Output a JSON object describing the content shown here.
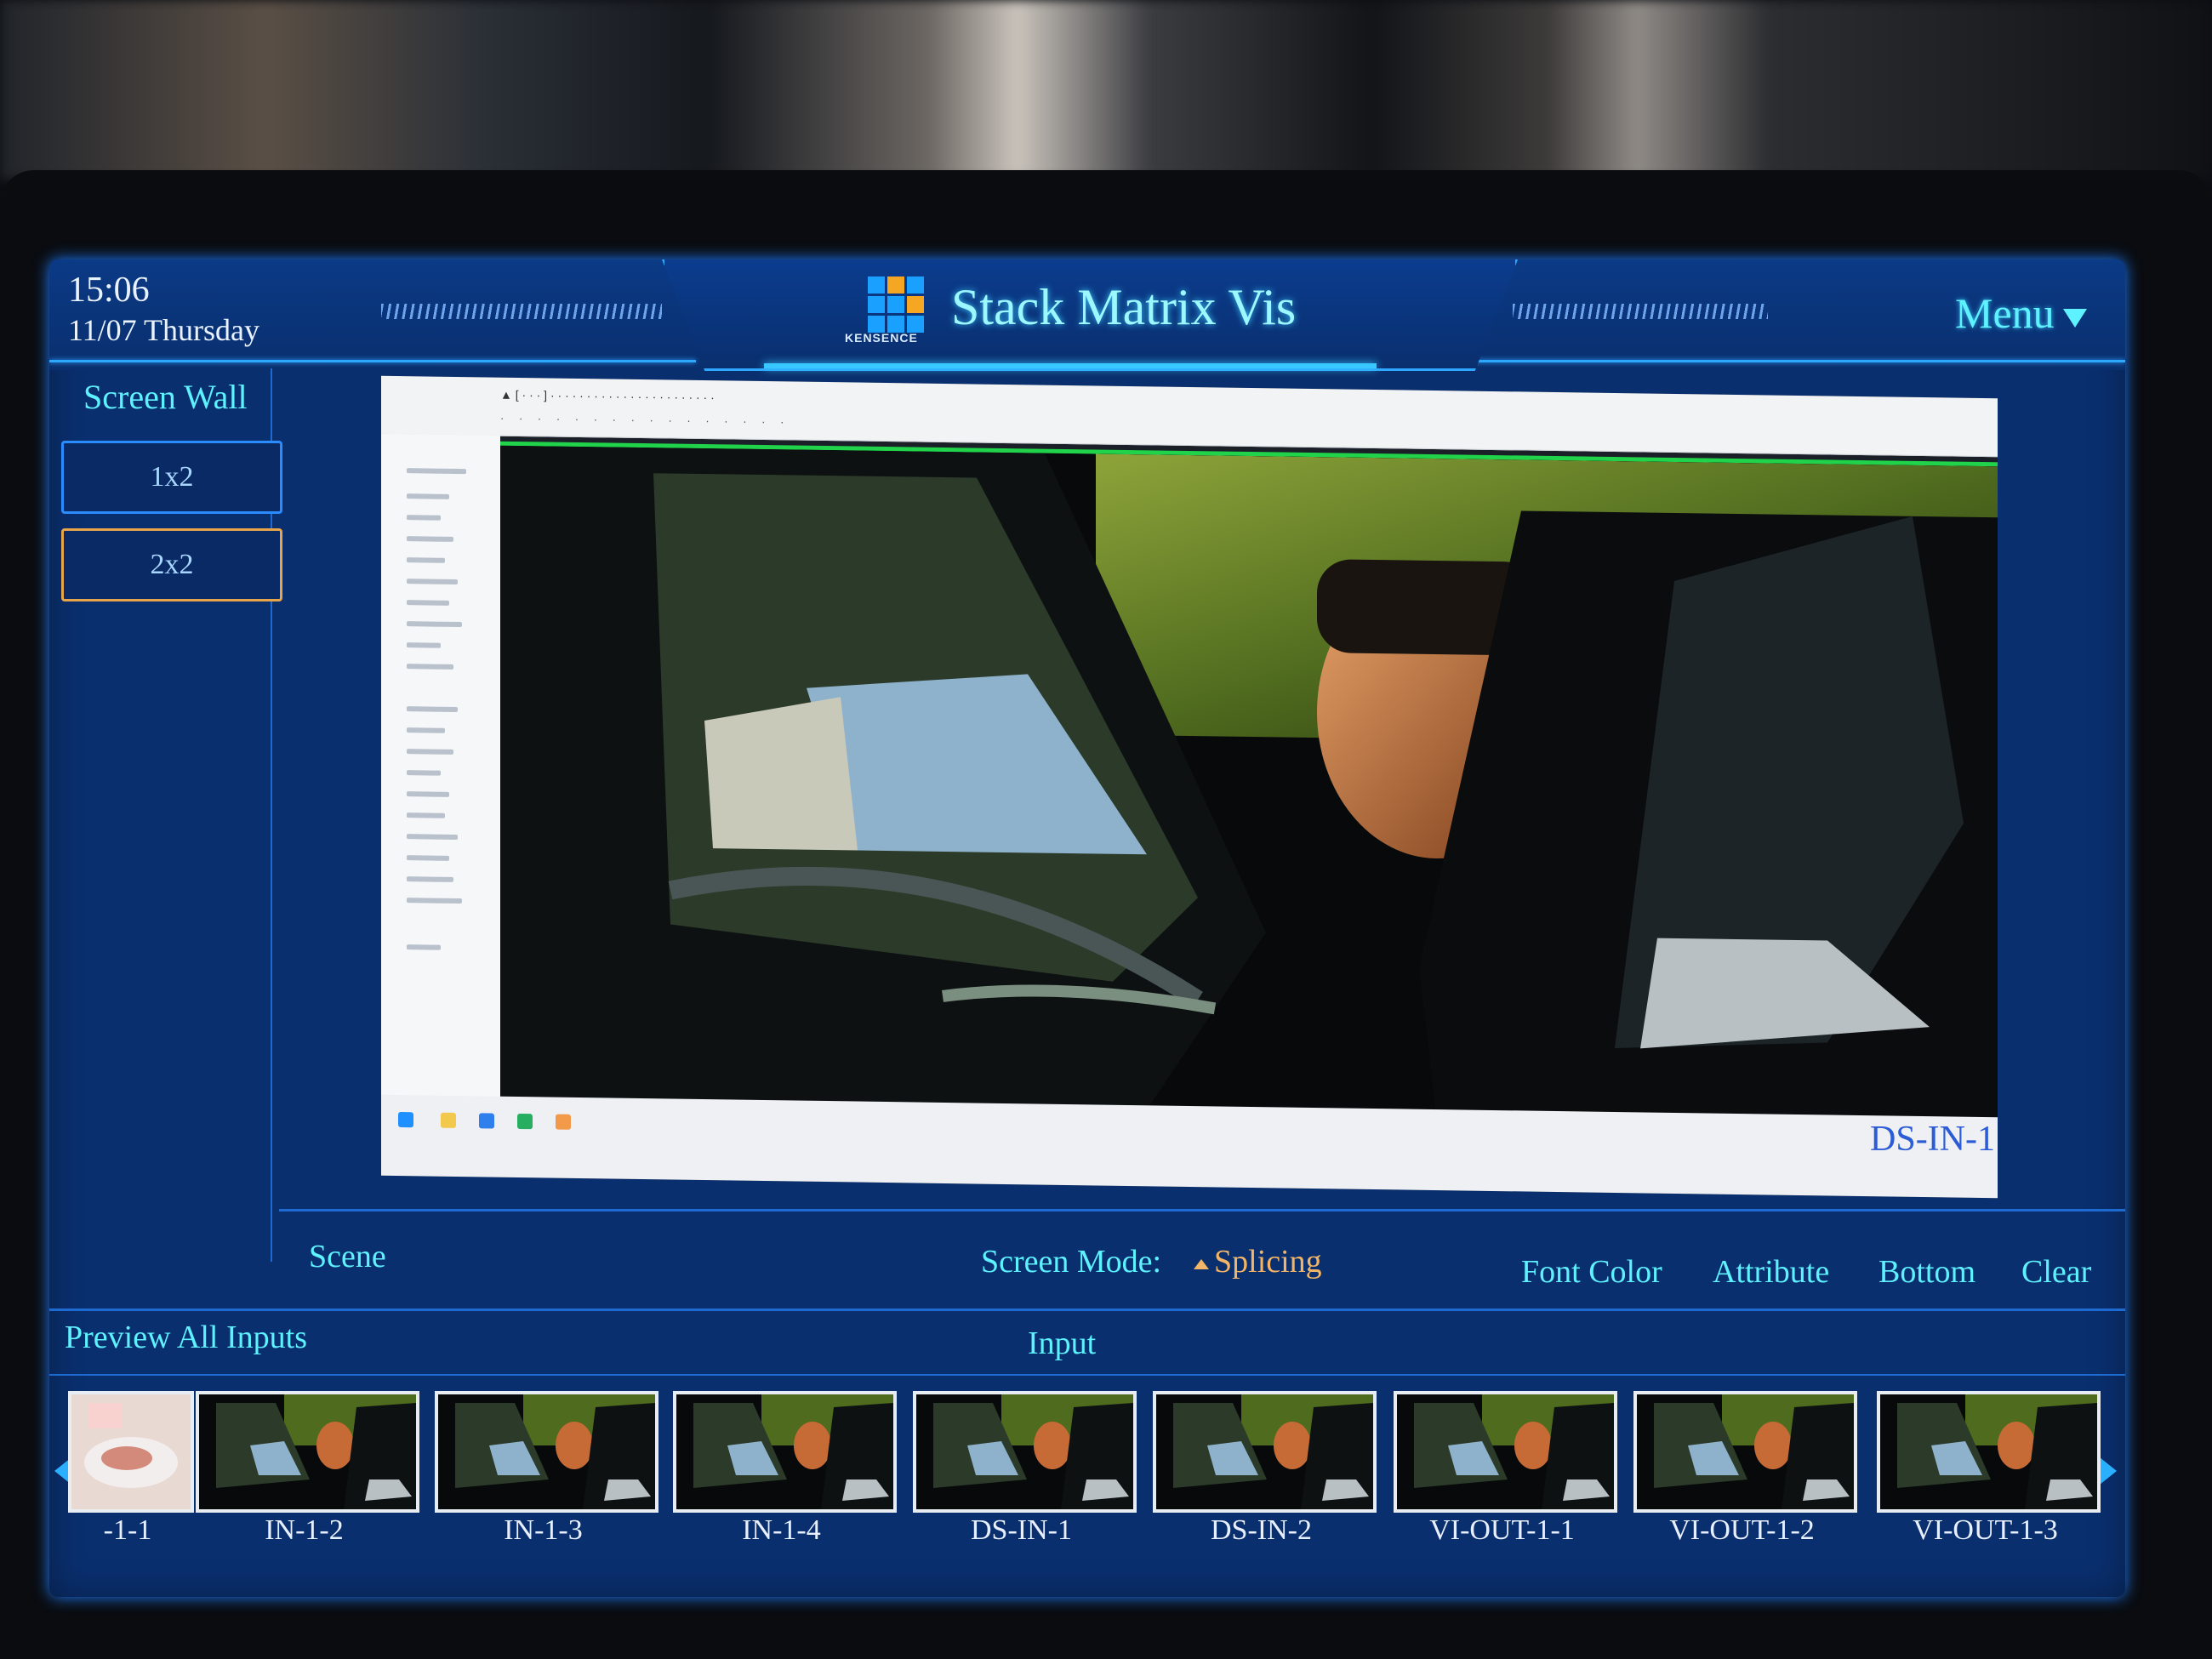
{
  "header": {
    "time": "15:06",
    "date": "11/07 Thursday",
    "app_title": "Stack Matrix Vis",
    "logo_text": "KENSENCE",
    "menu_label": "Menu"
  },
  "sidebar": {
    "title": "Screen Wall",
    "layouts": [
      {
        "label": "1x2",
        "active": false
      },
      {
        "label": "2x2",
        "active": true
      }
    ]
  },
  "preview": {
    "source_label": "DS-IN-1"
  },
  "toolbar": {
    "scene_label": "Scene",
    "screen_mode_label": "Screen Mode:",
    "screen_mode_value": "Splicing",
    "font_color_label": "Font Color",
    "attribute_label": "Attribute",
    "bottom_label": "Bottom",
    "clear_label": "Clear"
  },
  "inputs": {
    "preview_all_label": "Preview All Inputs",
    "section_label": "Input",
    "items": [
      "-1-1",
      "IN-1-2",
      "IN-1-3",
      "IN-1-4",
      "DS-IN-1",
      "DS-IN-2",
      "VI-OUT-1-1",
      "VI-OUT-1-2",
      "VI-OUT-1-3"
    ]
  },
  "colors": {
    "accent_cyan": "#5ef1ff",
    "panel_blue": "#0a2f6e",
    "border_blue": "#2a8cff",
    "active_orange": "#e6a54b",
    "mode_orange": "#f2b466"
  }
}
